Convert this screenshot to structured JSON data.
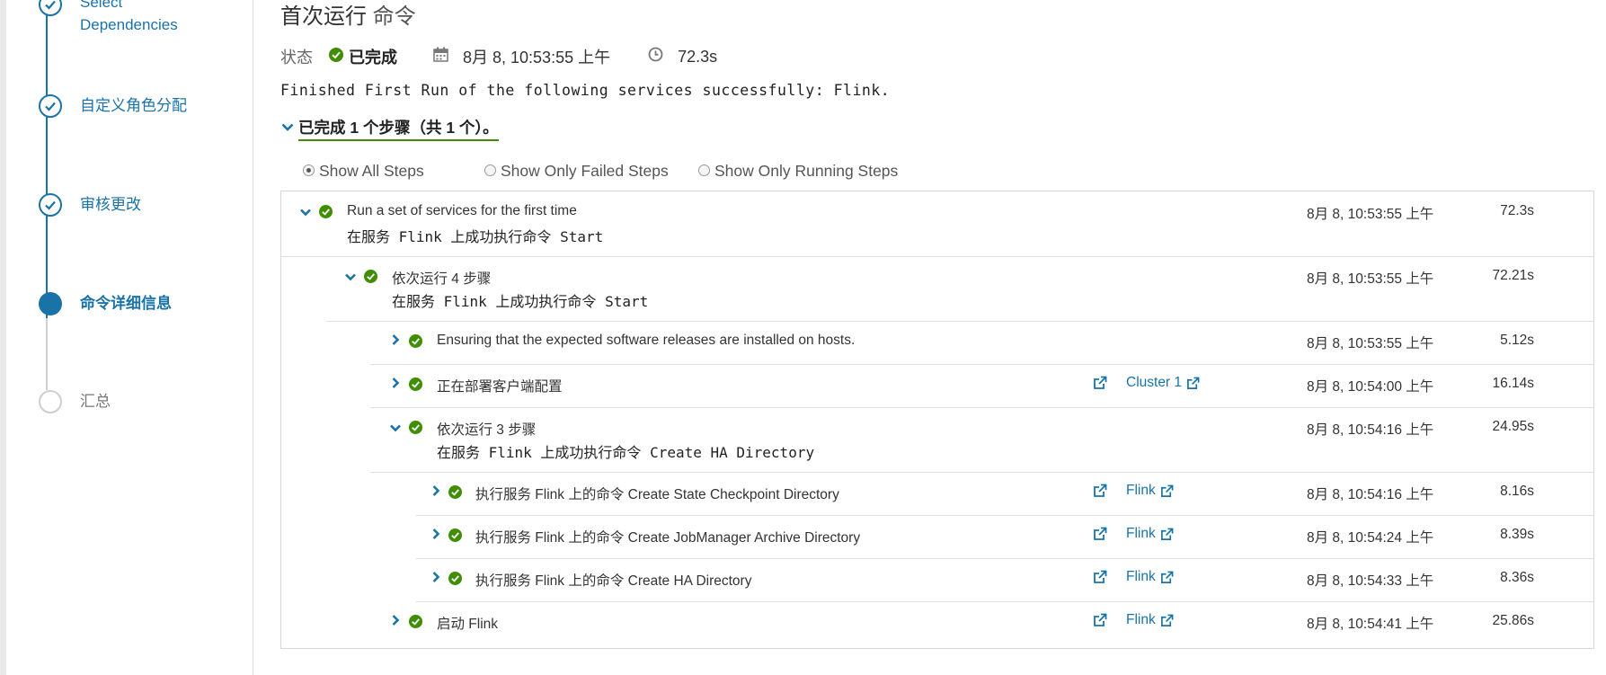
{
  "wizard": {
    "steps": [
      {
        "label": "Select\nDependencies",
        "line1": "Select",
        "line2": "Dependencies",
        "state": "done"
      },
      {
        "label": "自定义角色分配",
        "state": "done"
      },
      {
        "label": "审核更改",
        "state": "done"
      },
      {
        "label": "命令详细信息",
        "state": "current"
      },
      {
        "label": "汇总",
        "state": "todo"
      }
    ]
  },
  "header": {
    "title": "首次运行",
    "title_suffix": "命令",
    "status_label": "状态",
    "status_value": "已完成",
    "start_time": "8月 8, 10:53:55 上午",
    "duration": "72.3s"
  },
  "summary": "Finished First Run of the following services successfully: Flink.",
  "completed_toggle": "已完成 1 个步骤（共 1 个）。",
  "filters": [
    {
      "label": "Show All Steps",
      "checked": true
    },
    {
      "label": "Show Only Failed Steps",
      "checked": false
    },
    {
      "label": "Show Only Running Steps",
      "checked": false
    }
  ],
  "rows": [
    {
      "title": "Run a set of services for the first time",
      "detail": "在服务 Flink 上成功执行命令 Start",
      "time": "8月 8, 10:53:55 上午",
      "duration": "72.3s",
      "expanded": true
    },
    {
      "title": "依次运行 4 步骤",
      "detail": "在服务 Flink 上成功执行命令 Start",
      "time": "8月 8, 10:53:55 上午",
      "duration": "72.21s",
      "expanded": true
    },
    {
      "title": "Ensuring that the expected software releases are installed on hosts.",
      "time": "8月 8, 10:53:55 上午",
      "duration": "5.12s",
      "expanded": false
    },
    {
      "title": "正在部署客户端配置",
      "link": "Cluster 1",
      "time": "8月 8, 10:54:00 上午",
      "duration": "16.14s",
      "expanded": false
    },
    {
      "title": "依次运行 3 步骤",
      "detail": "在服务 Flink 上成功执行命令 Create HA Directory",
      "time": "8月 8, 10:54:16 上午",
      "duration": "24.95s",
      "expanded": true
    },
    {
      "title": "执行服务 Flink 上的命令 Create State Checkpoint Directory",
      "link": "Flink",
      "time": "8月 8, 10:54:16 上午",
      "duration": "8.16s",
      "expanded": false
    },
    {
      "title": "执行服务 Flink 上的命令 Create JobManager Archive Directory",
      "link": "Flink",
      "time": "8月 8, 10:54:24 上午",
      "duration": "8.39s",
      "expanded": false
    },
    {
      "title": "执行服务 Flink 上的命令 Create HA Directory",
      "link": "Flink",
      "time": "8月 8, 10:54:33 上午",
      "duration": "8.36s",
      "expanded": false
    },
    {
      "title": "启动 Flink",
      "link": "Flink",
      "time": "8月 8, 10:54:41 上午",
      "duration": "25.86s",
      "expanded": false
    }
  ],
  "colors": {
    "accent": "#1a73a8",
    "success": "#3e8e00"
  }
}
